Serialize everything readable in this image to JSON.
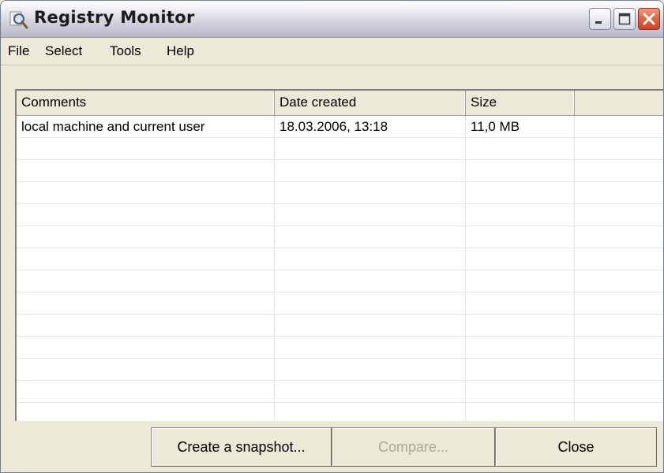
{
  "window": {
    "title": "Registry Monitor",
    "app_icon": "magnifier-icon",
    "controls": {
      "minimize_icon": "minimize-icon",
      "maximize_icon": "maximize-icon",
      "close_icon": "close-icon"
    }
  },
  "menu": {
    "items": [
      {
        "label": "File"
      },
      {
        "label": "Select"
      },
      {
        "label": "Tools"
      },
      {
        "label": "Help"
      }
    ]
  },
  "table": {
    "columns": [
      "Comments",
      "Date created",
      "Size",
      ""
    ],
    "rows": [
      [
        "local machine and current user",
        "18.03.2006, 13:18",
        "11,0 MB",
        ""
      ]
    ]
  },
  "buttons": {
    "snapshot": "Create a snapshot...",
    "compare": "Compare...",
    "close": "Close"
  },
  "colors": {
    "background": "#ece9d8",
    "close_button": "#e06c4c",
    "disabled_text": "#aca899"
  }
}
